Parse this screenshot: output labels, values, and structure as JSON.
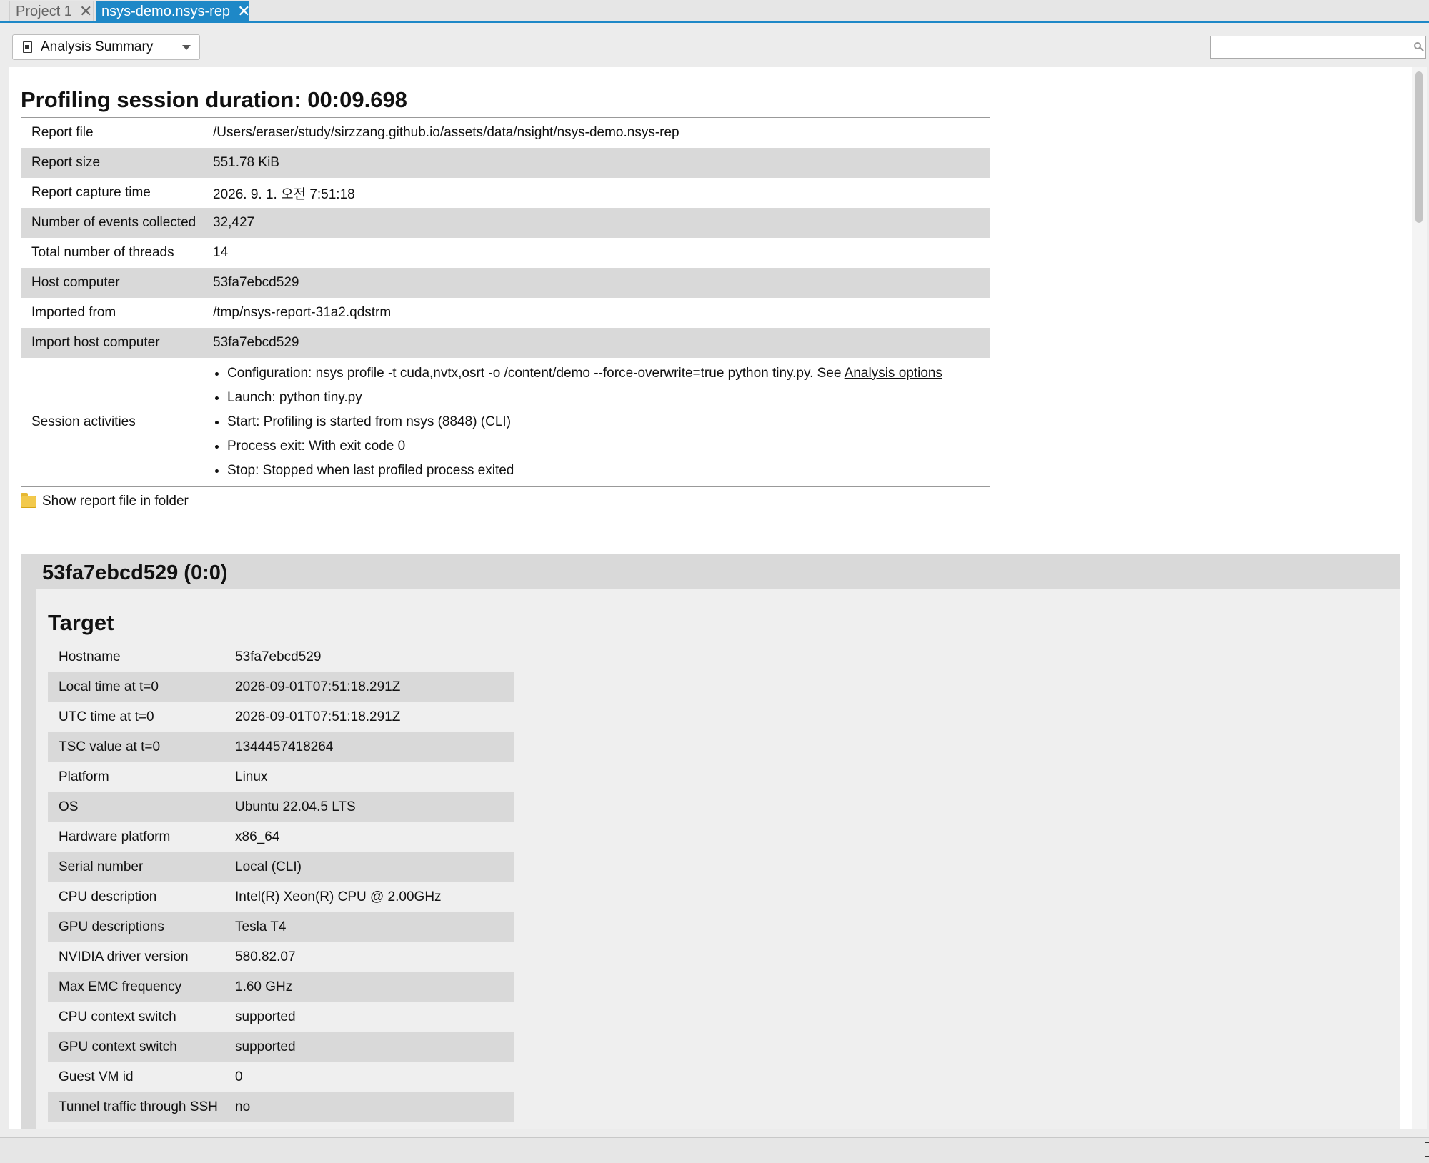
{
  "tabs": [
    {
      "label": "Project 1",
      "active": false
    },
    {
      "label": "nsys-demo.nsys-rep",
      "active": true
    }
  ],
  "close_glyph": "✕",
  "toolbar": {
    "view_select": "Analysis Summary",
    "search_placeholder": ""
  },
  "summary": {
    "title": "Profiling session duration: 00:09.698",
    "rows": [
      {
        "key": "Report file",
        "value": "/Users/eraser/study/sirzzang.github.io/assets/data/nsight/nsys-demo.nsys-rep"
      },
      {
        "key": "Report size",
        "value": "551.78 KiB"
      },
      {
        "key": "Report capture time",
        "value": "2026. 9. 1. 오전 7:51:18"
      },
      {
        "key": "Number of events collected",
        "value": "32,427"
      },
      {
        "key": "Total number of threads",
        "value": "14"
      },
      {
        "key": "Host computer",
        "value": "53fa7ebcd529"
      },
      {
        "key": "Imported from",
        "value": "/tmp/nsys-report-31a2.qdstrm"
      },
      {
        "key": "Import host computer",
        "value": "53fa7ebcd529"
      }
    ],
    "activities_label": "Session activities",
    "activities": {
      "configuration_text": "Configuration: nsys profile -t cuda,nvtx,osrt -o /content/demo --force-overwrite=true python tiny.py. See",
      "configuration_link": "Analysis options",
      "launch": "Launch: python tiny.py",
      "start": "Start: Profiling is started from nsys (8848) (CLI)",
      "process_exit": "Process exit: With exit code 0",
      "stop": "Stop: Stopped when last profiled process exited"
    },
    "show_folder_link": "Show report file in folder"
  },
  "host": {
    "title": "53fa7ebcd529 (0:0)",
    "target_heading": "Target",
    "rows": [
      {
        "key": "Hostname",
        "value": "53fa7ebcd529"
      },
      {
        "key": "Local time at t=0",
        "value": "2026-09-01T07:51:18.291Z"
      },
      {
        "key": "UTC time at t=0",
        "value": "2026-09-01T07:51:18.291Z"
      },
      {
        "key": "TSC value at t=0",
        "value": "1344457418264"
      },
      {
        "key": "Platform",
        "value": "Linux"
      },
      {
        "key": "OS",
        "value": "Ubuntu 22.04.5 LTS"
      },
      {
        "key": "Hardware platform",
        "value": "x86_64"
      },
      {
        "key": "Serial number",
        "value": "Local (CLI)"
      },
      {
        "key": "CPU description",
        "value": "Intel(R) Xeon(R) CPU @ 2.00GHz"
      },
      {
        "key": "GPU descriptions",
        "value": "Tesla T4"
      },
      {
        "key": "NVIDIA driver version",
        "value": "580.82.07"
      },
      {
        "key": "Max EMC frequency",
        "value": "1.60 GHz"
      },
      {
        "key": "CPU context switch",
        "value": "supported"
      },
      {
        "key": "GPU context switch",
        "value": "supported"
      },
      {
        "key": "Guest VM id",
        "value": "0"
      },
      {
        "key": "Tunnel traffic through SSH",
        "value": "no"
      }
    ]
  }
}
